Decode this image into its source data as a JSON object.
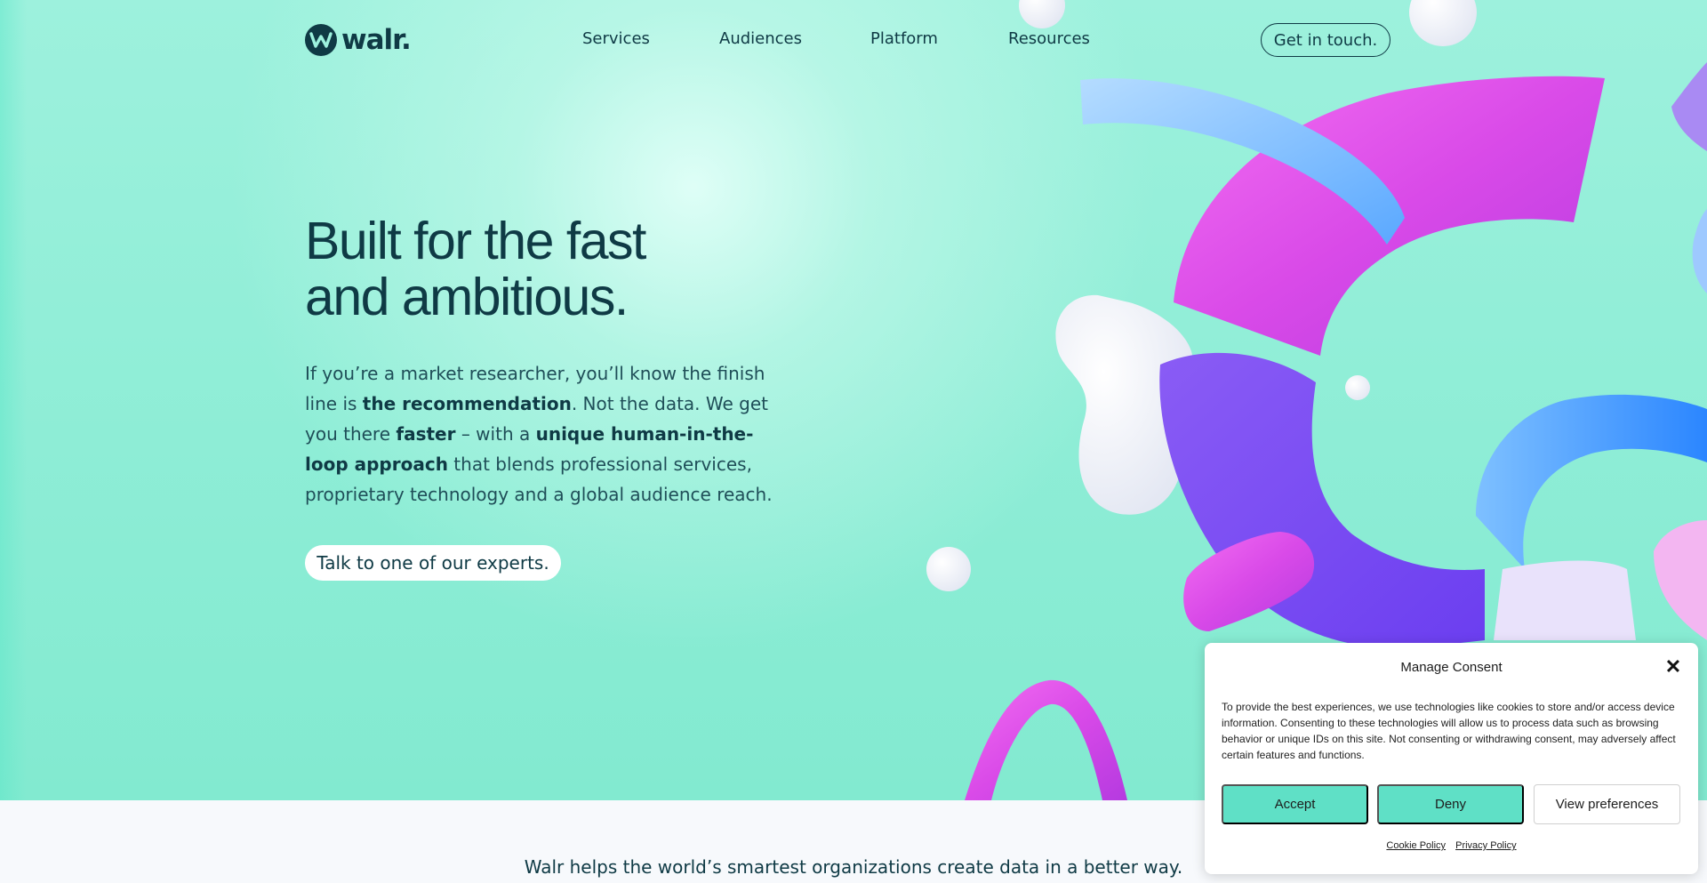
{
  "nav": {
    "logo_text": "walr.",
    "items": [
      {
        "label": "Services"
      },
      {
        "label": "Audiences"
      },
      {
        "label": "Platform"
      },
      {
        "label": "Resources"
      }
    ],
    "cta": "Get in touch."
  },
  "hero": {
    "headline_line1": "Built for the fast",
    "headline_line2": "and ambitious.",
    "intro": {
      "p1": "If you’re a market researcher, you’ll know the finish line is ",
      "b1": "the recommendation",
      "p2": ". Not the data. We get you there ",
      "b2": "faster",
      "p3": " – with a ",
      "b3": "unique human-in-the-loop approach",
      "p4": " that blends professional services, proprietary technology and a global audience reach."
    },
    "cta": "Talk to one of our experts."
  },
  "tagline": "Walr helps the world’s smartest organizations create data in a better way.",
  "consent": {
    "title": "Manage Consent",
    "close_icon": "close-icon",
    "text": "To provide the best experiences, we use technologies like cookies to store and/or access device information. Consenting to these technologies will allow us to process data such as browsing behavior or unique IDs on this site. Not consenting or withdrawing consent, may adversely affect certain features and functions.",
    "accept": "Accept",
    "deny": "Deny",
    "preferences": "View preferences",
    "cookie_policy": "Cookie Policy",
    "privacy_policy": "Privacy Policy"
  },
  "colors": {
    "brand_dark": "#0f3a45",
    "hero_bg": "#9df1dd",
    "consent_button": "#5fe0c6"
  }
}
